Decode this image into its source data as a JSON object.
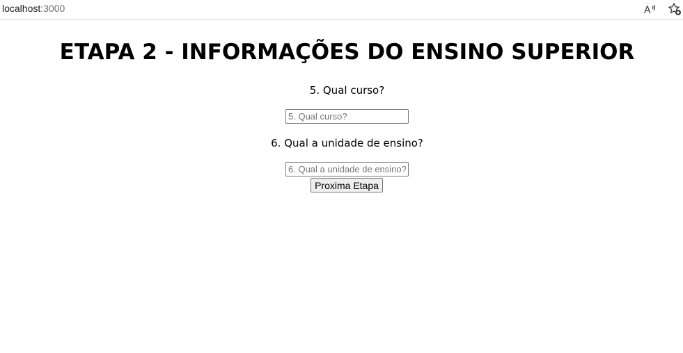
{
  "browser": {
    "url_host": "localhost",
    "url_port": ":3000",
    "icons": [
      "read-aloud-icon",
      "favorite-add-icon"
    ]
  },
  "page": {
    "title": "ETAPA 2 - INFORMAÇÕES DO ENSINO SUPERIOR",
    "question_5": {
      "label": "5. Qual curso?",
      "placeholder": "5. Qual curso?",
      "value": ""
    },
    "question_6": {
      "label": "6. Qual a unidade de ensino?",
      "placeholder": "6. Qual a unidade de ensino?",
      "value": ""
    },
    "next_button_label": "Proxima Etapa"
  }
}
